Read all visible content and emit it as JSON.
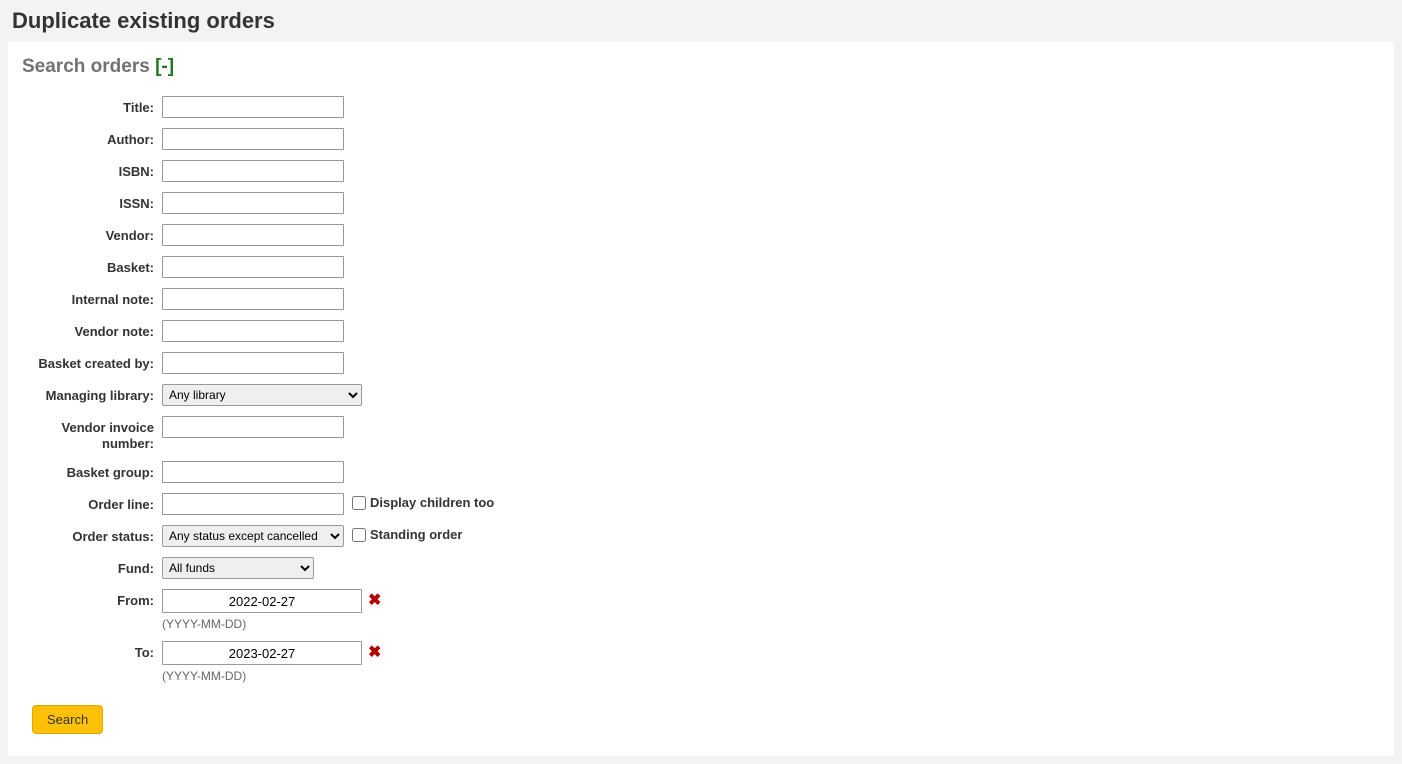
{
  "page_title": "Duplicate existing orders",
  "legend": {
    "text": "Search orders",
    "toggle": "[-]"
  },
  "fields": {
    "title_label": "Title:",
    "author_label": "Author:",
    "isbn_label": "ISBN:",
    "issn_label": "ISSN:",
    "vendor_label": "Vendor:",
    "basket_label": "Basket:",
    "internal_note_label": "Internal note:",
    "vendor_note_label": "Vendor note:",
    "basket_created_by_label": "Basket created by:",
    "managing_library_label": "Managing library:",
    "managing_library_value": "Any library",
    "vendor_invoice_label": "Vendor invoice number:",
    "basket_group_label": "Basket group:",
    "order_line_label": "Order line:",
    "display_children_label": "Display children too",
    "order_status_label": "Order status:",
    "order_status_value": "Any status except cancelled",
    "standing_order_label": "Standing order",
    "fund_label": "Fund:",
    "fund_value": "All funds",
    "from_label": "From:",
    "from_value": "2022-02-27",
    "to_label": "To:",
    "to_value": "2023-02-27",
    "date_hint": "(YYYY-MM-DD)"
  },
  "buttons": {
    "search": "Search"
  }
}
